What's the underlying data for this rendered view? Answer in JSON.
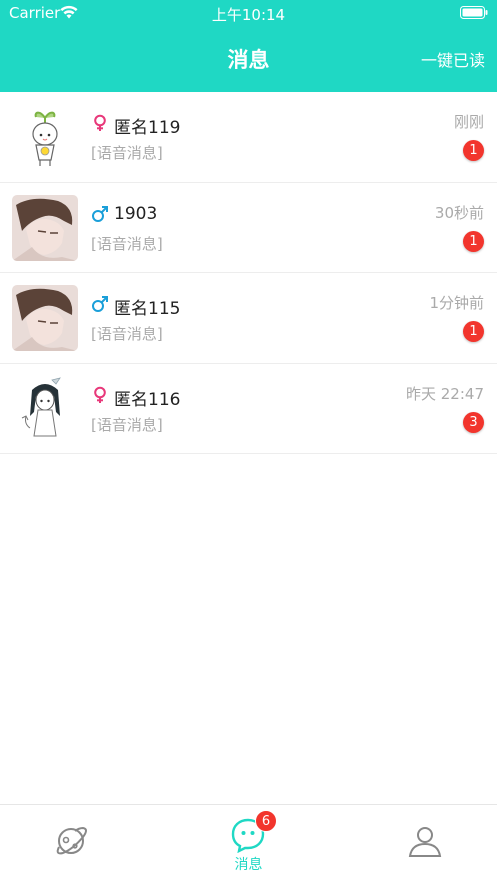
{
  "status_bar": {
    "carrier": "Carrier",
    "time": "上午10:14"
  },
  "nav": {
    "title": "消息",
    "mark_all_read": "一键已读"
  },
  "conversations": [
    {
      "name": "匿名119",
      "gender": "female",
      "gender_icon": "female-symbol-icon",
      "preview": "[语音消息]",
      "time": "刚刚",
      "unread": "1",
      "avatar": "cartoon-girl-sprout-avatar"
    },
    {
      "name": "1903",
      "gender": "male",
      "gender_icon": "male-symbol-icon",
      "preview": "[语音消息]",
      "time": "30秒前",
      "unread": "1",
      "avatar": "anime-boy-avatar"
    },
    {
      "name": "匿名115",
      "gender": "male",
      "gender_icon": "male-symbol-icon",
      "preview": "[语音消息]",
      "time": "1分钟前",
      "unread": "1",
      "avatar": "anime-boy-avatar"
    },
    {
      "name": "匿名116",
      "gender": "female",
      "gender_icon": "female-symbol-icon",
      "preview": "[语音消息]",
      "time": "昨天 22:47",
      "unread": "3",
      "avatar": "anime-girl-sketch-avatar"
    }
  ],
  "tabbar": {
    "tabs": [
      {
        "icon": "planet-icon",
        "label": "",
        "active": false
      },
      {
        "icon": "chat-bubble-icon",
        "label": "消息",
        "active": true,
        "badge": "6"
      },
      {
        "icon": "person-icon",
        "label": "",
        "active": false
      }
    ]
  },
  "colors": {
    "accent": "#1fd8c4",
    "badge": "#f2352d",
    "female": "#e8387a",
    "male": "#1a9fd9",
    "secondary_text": "#aaaaaa"
  }
}
